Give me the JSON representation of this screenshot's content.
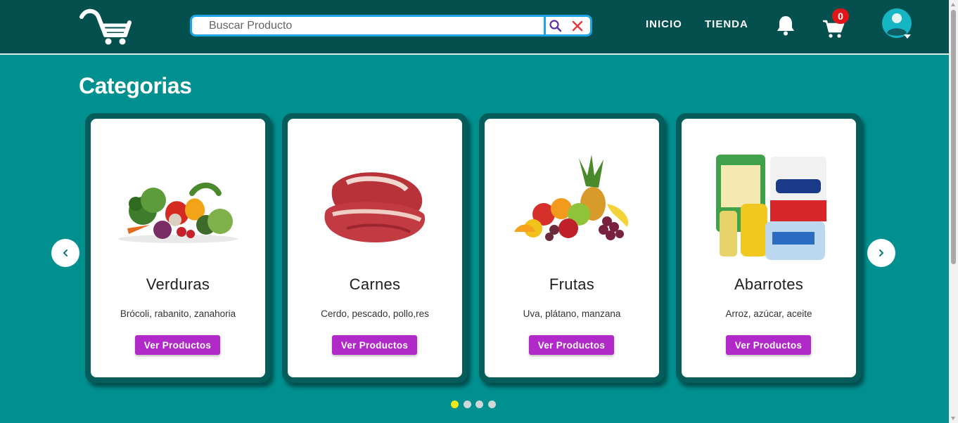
{
  "header": {
    "logo_icon": "cart-logo-icon",
    "search": {
      "placeholder": "Buscar Producto",
      "value": ""
    },
    "nav": {
      "inicio": "INICIO",
      "tienda": "TIENDA"
    },
    "cart_count": "0"
  },
  "main": {
    "title": "Categorias",
    "categories": [
      {
        "name": "Verduras",
        "description": "Brócoli, rabanito, zanahoria",
        "button": "Ver Productos"
      },
      {
        "name": "Carnes",
        "description": "Cerdo, pescado, pollo,res",
        "button": "Ver Productos"
      },
      {
        "name": "Frutas",
        "description": "Uva, plátano, manzana",
        "button": "Ver Productos"
      },
      {
        "name": "Abarrotes",
        "description": "Arroz, azúcar, aceite",
        "button": "Ver Productos"
      }
    ],
    "carousel": {
      "pages": 4,
      "active_page": 1
    }
  },
  "colors": {
    "header_bg": "#03504f",
    "page_bg": "#009090",
    "button": "#b129c9",
    "search_border": "#1aa6e6",
    "badge": "#e0161a",
    "active_dot": "#f0ea14"
  }
}
